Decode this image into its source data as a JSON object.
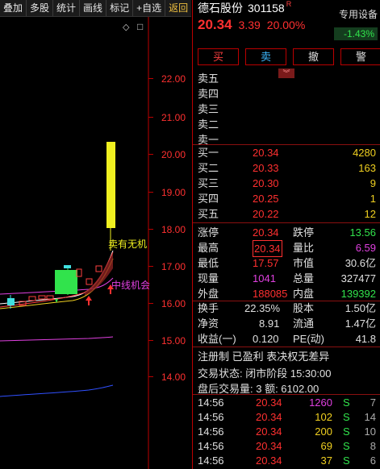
{
  "toolbar": {
    "items": [
      "叠加",
      "多股",
      "统计",
      "画线",
      "标记",
      "+自选",
      "返回"
    ]
  },
  "chart": {
    "price_labels": [
      "22.00",
      "21.00",
      "20.00",
      "19.00",
      "18.00",
      "17.00",
      "16.00",
      "15.00",
      "14.00"
    ],
    "annotations": {
      "top": "卖有无机",
      "mid": "中线机会"
    },
    "top_icons": [
      "◇",
      "□"
    ]
  },
  "stock": {
    "name": "德石股份",
    "code": "301158",
    "flag": "R",
    "price": "20.34",
    "change": "3.39",
    "pct": "20.00%",
    "device_label": "专用设备",
    "device_change": "-1.43%"
  },
  "buttons": {
    "buy": "买",
    "sell": "卖",
    "cancel": "撤",
    "alert": "警"
  },
  "asks": [
    "卖五",
    "卖四",
    "卖三",
    "卖二",
    "卖一"
  ],
  "bids": [
    {
      "label": "买一",
      "price": "20.34",
      "vol": "4280"
    },
    {
      "label": "买二",
      "price": "20.33",
      "vol": "163"
    },
    {
      "label": "买三",
      "price": "20.30",
      "vol": "9"
    },
    {
      "label": "买四",
      "price": "20.25",
      "vol": "1"
    },
    {
      "label": "买五",
      "price": "20.22",
      "vol": "12"
    }
  ],
  "stats": {
    "zt_l": "涨停",
    "zt_v": "20.34",
    "dt_l": "跌停",
    "dt_v": "13.56",
    "zg_l": "最高",
    "zg_v": "20.34",
    "lb_l": "量比",
    "lb_v": "6.59",
    "zd_l": "最低",
    "zd_v": "17.57",
    "sz_l": "市值",
    "sz_v": "30.6亿",
    "xl_l": "现量",
    "xl_v": "1041",
    "zl_l": "总量",
    "zl_v": "327477",
    "wp_l": "外盘",
    "wp_v": "188085",
    "np_l": "内盘",
    "np_v": "139392"
  },
  "fin": {
    "hs_l": "换手",
    "hs_v": "22.35%",
    "gb_l": "股本",
    "gb_v": "1.50亿",
    "jz_l": "净资",
    "jz_v": "8.91",
    "lt_l": "流通",
    "lt_v": "1.47亿",
    "sy_l": "收益(一)",
    "sy_v": "0.120",
    "pe_l": "PE(动)",
    "pe_v": "41.8"
  },
  "tags": "注册制 已盈利 表决权无差异",
  "status": "交易状态: 闭市阶段 15:30:00",
  "after": "盘后交易量: 3  额: 6102.00",
  "ticks": [
    {
      "t": "14:56",
      "p": "20.34",
      "v": "1260",
      "s": "S",
      "n": "7"
    },
    {
      "t": "14:56",
      "p": "20.34",
      "v": "102",
      "s": "S",
      "n": "14"
    },
    {
      "t": "14:56",
      "p": "20.34",
      "v": "200",
      "s": "S",
      "n": "10"
    },
    {
      "t": "14:56",
      "p": "20.34",
      "v": "69",
      "s": "S",
      "n": "8"
    },
    {
      "t": "14:56",
      "p": "20.34",
      "v": "37",
      "s": "S",
      "n": "6"
    }
  ]
}
